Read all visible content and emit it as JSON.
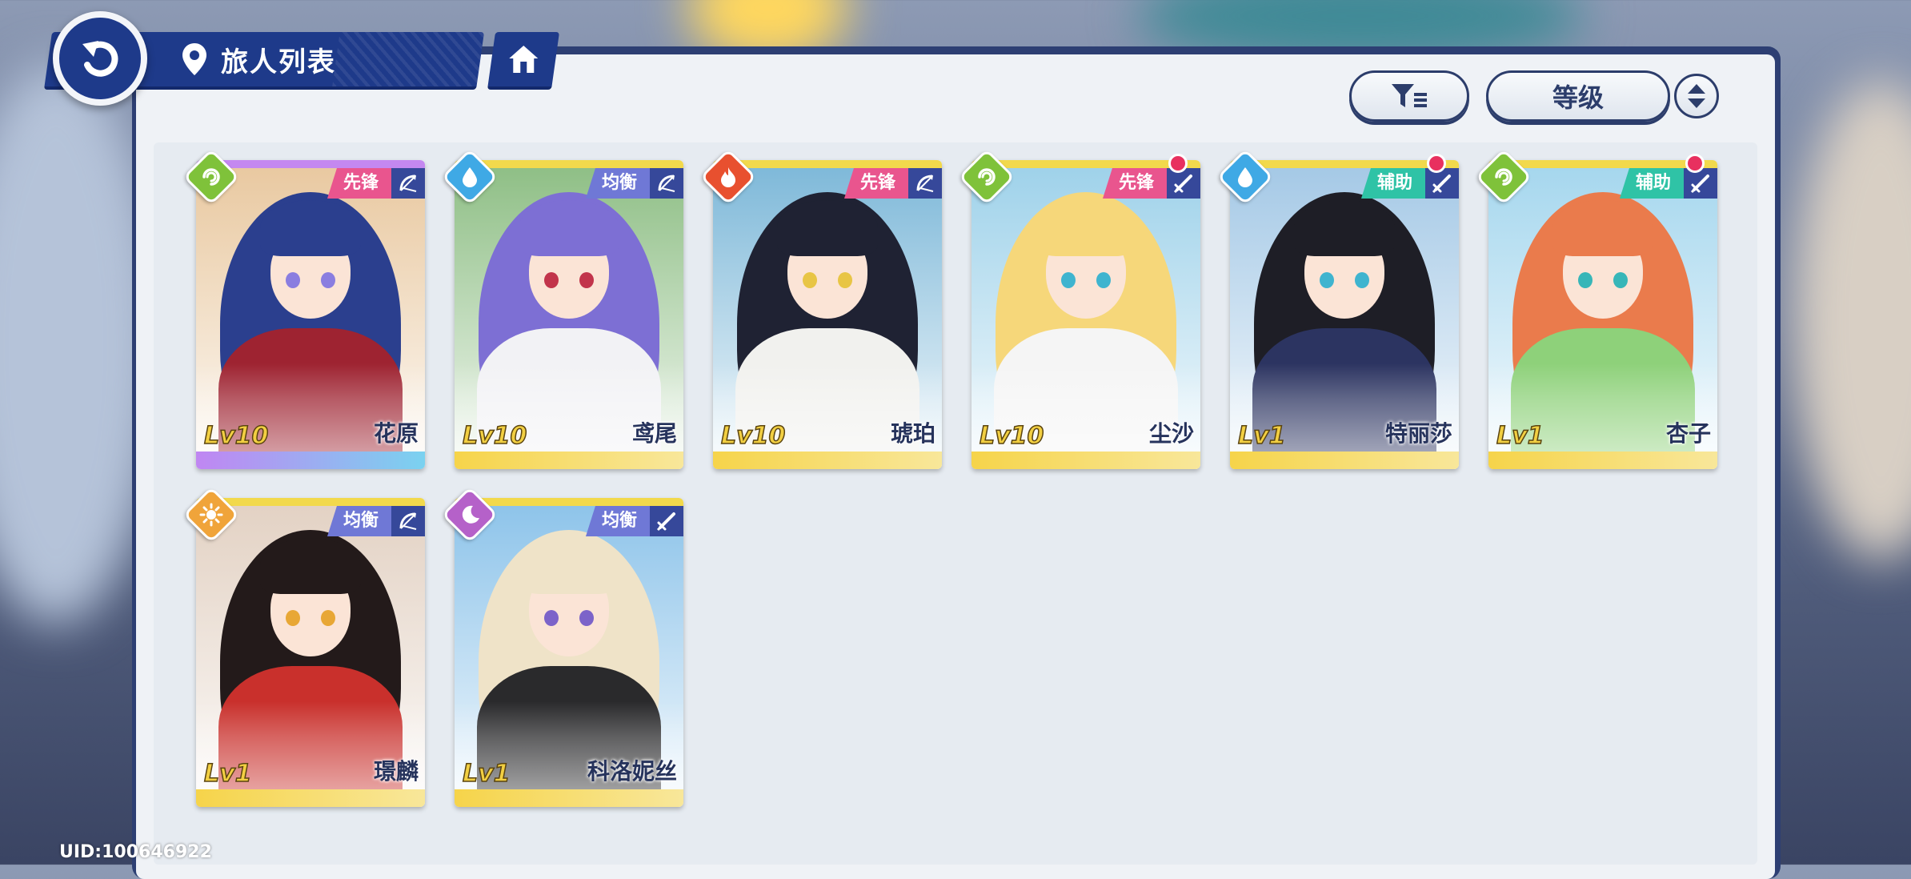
{
  "header": {
    "title": "旅人列表"
  },
  "toolbar": {
    "sort_label": "等级"
  },
  "characters": [
    {
      "name": "花原",
      "level": "Lv10",
      "role": "先锋",
      "element": "wind",
      "weapon": "bow",
      "notify": false,
      "role_color": "#e9558e",
      "frame": "#c488f0",
      "hair": "#2b3f8e",
      "eye": "#8a7de0",
      "outfit": "#9e2331",
      "sky": "#e9c9a1"
    },
    {
      "name": "鸢尾",
      "level": "Lv10",
      "role": "均衡",
      "element": "water",
      "weapon": "bow",
      "notify": false,
      "role_color": "#6f78d6",
      "frame": "#f2d94c",
      "hair": "#7d6fd4",
      "eye": "#c2344b",
      "outfit": "#f2f2f5",
      "sky": "#8fbf86"
    },
    {
      "name": "琥珀",
      "level": "Lv10",
      "role": "先锋",
      "element": "fire",
      "weapon": "bow",
      "notify": false,
      "role_color": "#e9558e",
      "frame": "#f2d94c",
      "hair": "#1f2233",
      "eye": "#e8c545",
      "outfit": "#f1f1ee",
      "sky": "#7fb9d9"
    },
    {
      "name": "尘沙",
      "level": "Lv10",
      "role": "先锋",
      "element": "wind",
      "weapon": "sword",
      "notify": true,
      "role_color": "#e9558e",
      "frame": "#f2d94c",
      "hair": "#f6d77a",
      "eye": "#3fb4cf",
      "outfit": "#f5f5f5",
      "sky": "#9fd2ea"
    },
    {
      "name": "特丽莎",
      "level": "Lv1",
      "role": "辅助",
      "element": "water",
      "weapon": "sword",
      "notify": true,
      "role_color": "#2fc3a6",
      "frame": "#f2d94c",
      "hair": "#1e1e26",
      "eye": "#3fb4cf",
      "outfit": "#2c3461",
      "sky": "#a5c9e6"
    },
    {
      "name": "杏子",
      "level": "Lv1",
      "role": "辅助",
      "element": "wind",
      "weapon": "sword",
      "notify": true,
      "role_color": "#2fc3a6",
      "frame": "#f2d94c",
      "hair": "#ea7b4c",
      "eye": "#37b6b8",
      "outfit": "#8ed17a",
      "sky": "#a6d7ee"
    },
    {
      "name": "璟麟",
      "level": "Lv1",
      "role": "均衡",
      "element": "light",
      "weapon": "bow",
      "notify": false,
      "role_color": "#6f78d6",
      "frame": "#f2d94c",
      "hair": "#231a1a",
      "eye": "#e8a735",
      "outfit": "#c9302c",
      "sky": "#e3d2c4"
    },
    {
      "name": "科洛妮丝",
      "level": "Lv1",
      "role": "均衡",
      "element": "dark",
      "weapon": "sword",
      "notify": false,
      "role_color": "#6f78d6",
      "frame": "#f2d94c",
      "hair": "#efe3c8",
      "eye": "#7c63c9",
      "outfit": "#2a2a2c",
      "sky": "#8ec4ea"
    }
  ],
  "uid": "UID:100646922",
  "element_colors": {
    "wind": "#7fc23a",
    "water": "#3fa9e5",
    "fire": "#e8502f",
    "light": "#f0a43a",
    "dark": "#b561c9"
  }
}
